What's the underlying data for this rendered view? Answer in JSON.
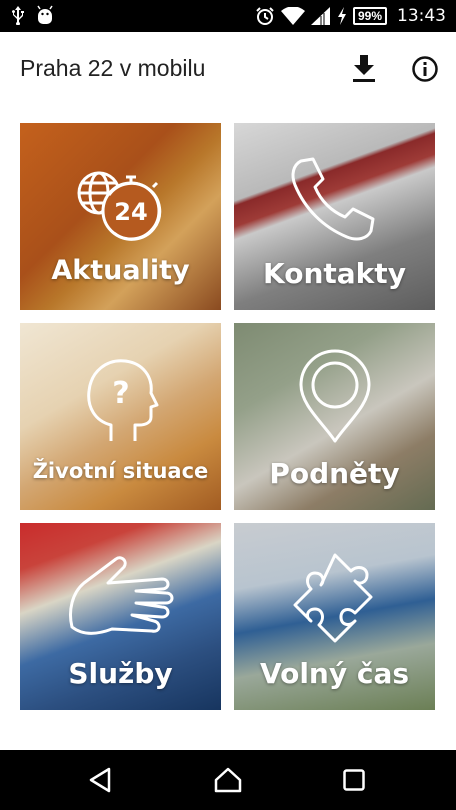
{
  "status_bar": {
    "left_icons": [
      "usb-icon",
      "android-debug-icon"
    ],
    "right_icons": [
      "alarm-icon",
      "wifi-icon",
      "signal-icon",
      "charging-icon"
    ],
    "battery": "99%",
    "time": "13:43"
  },
  "app_bar": {
    "title": "Praha 22 v mobilu",
    "actions": [
      "download-icon",
      "info-icon"
    ]
  },
  "tiles": [
    {
      "label": "Aktuality",
      "icon": "news-24-icon"
    },
    {
      "label": "Kontakty",
      "icon": "phone-icon"
    },
    {
      "label": "Životní situace",
      "icon": "head-question-icon"
    },
    {
      "label": "Podněty",
      "icon": "map-pin-icon"
    },
    {
      "label": "Služby",
      "icon": "hand-icon"
    },
    {
      "label": "Volný čas",
      "icon": "puzzle-icon"
    }
  ],
  "nav_bar": {
    "buttons": [
      "back-icon",
      "home-icon",
      "recent-apps-icon"
    ]
  },
  "colors": {
    "status_bar_bg": "#000000",
    "app_bar_bg": "#ffffff",
    "title_text": "#222222",
    "tile_label": "#ffffff"
  }
}
